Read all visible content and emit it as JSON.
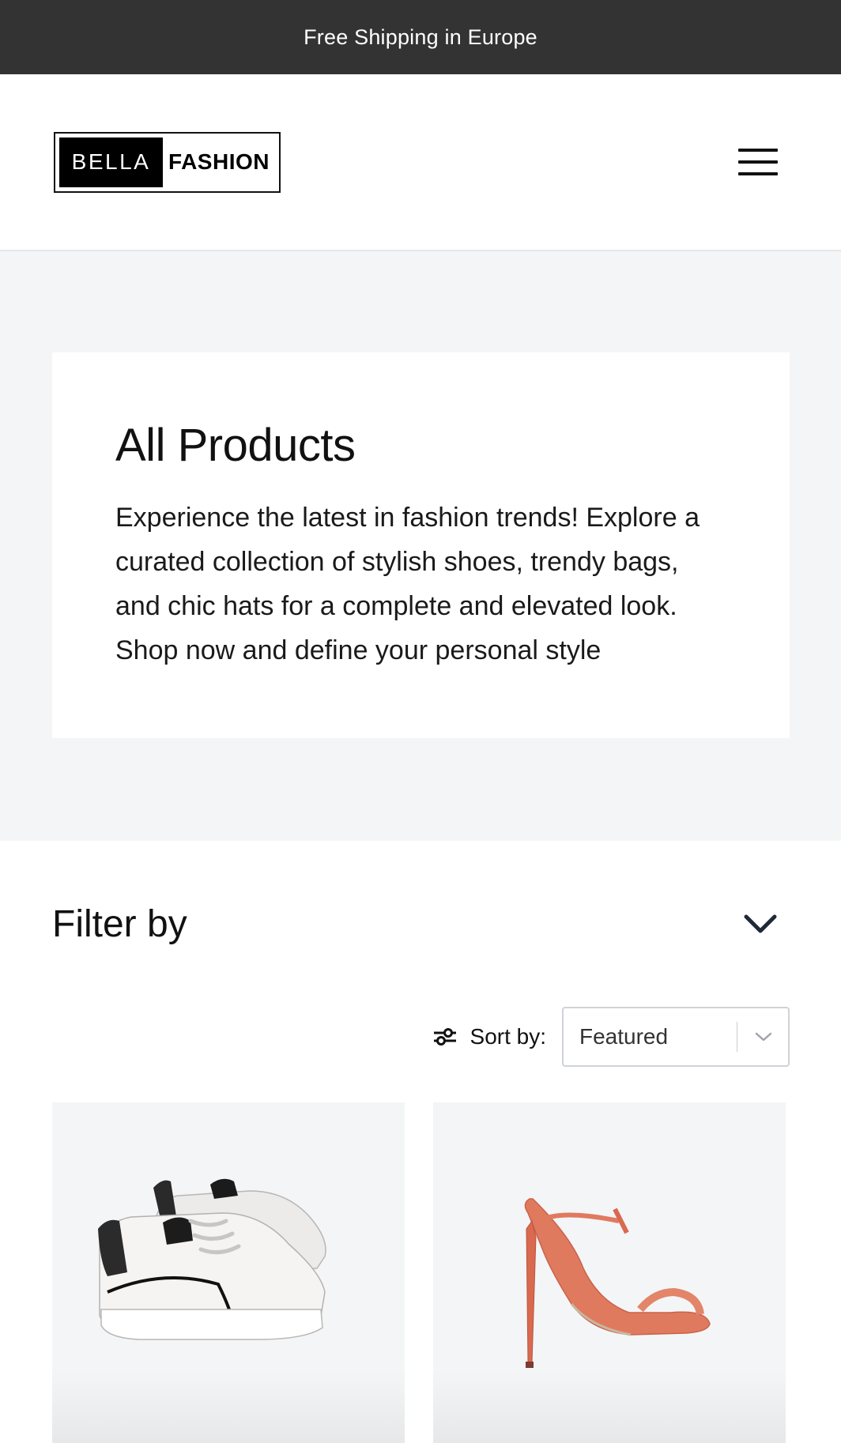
{
  "announcement": {
    "text": "Free Shipping in Europe"
  },
  "header": {
    "logo": {
      "left": "BELLA",
      "right": "FASHION"
    }
  },
  "hero": {
    "title": "All Products",
    "description": "Experience the latest in fashion trends! Explore a curated collection of stylish shoes, trendy bags, and chic hats for a complete and elevated look. Shop now and define your personal style"
  },
  "filters": {
    "label": "Filter by"
  },
  "sort": {
    "label": "Sort by:",
    "selected": "Featured"
  },
  "products": [
    {
      "image": "white-sneakers"
    },
    {
      "image": "coral-high-heel-sandal"
    }
  ]
}
